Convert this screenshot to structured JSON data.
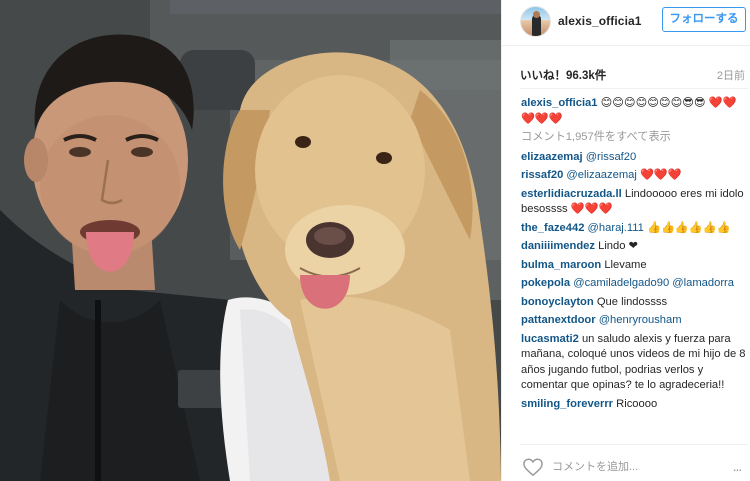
{
  "post": {
    "photo_alt": "Selfie with golden retriever in car",
    "icon": "photo"
  },
  "header": {
    "username": "alexis_officia1",
    "follow_label": "フォローする",
    "avatar_icon": "avatar-image"
  },
  "stats": {
    "likes": "いいね！96.3k件",
    "time": "2日前"
  },
  "caption": {
    "user": "alexis_officia1",
    "text": "😊😊😊😊😊😊😊😎😎 ❤️❤️❤️❤️❤️"
  },
  "view_all_comments": "コメント1,957件をすべて表示",
  "comments": [
    {
      "user": "elizaazemaj",
      "mention": "@rissaf20",
      "text": ""
    },
    {
      "user": "rissaf20",
      "mention": "@elizaazemaj",
      "text": "❤️❤️❤️"
    },
    {
      "user": "esterlidiacruzada.ll",
      "mention": "",
      "text": "Lindooooo eres mi idolo besossss ❤️❤️❤️"
    },
    {
      "user": "the_faze442",
      "mention": "@haraj.111",
      "text": "👍👍👍👍👍👍"
    },
    {
      "user": "daniiiimendez",
      "mention": "",
      "text": "Lindo ❤"
    },
    {
      "user": "bulma_maroon",
      "mention": "",
      "text": "Llevame"
    },
    {
      "user": "pokepola",
      "mention": "@camiladelgado90 @lamadorra",
      "text": ""
    },
    {
      "user": "bonoyclayton",
      "mention": "",
      "text": "Que lindossss"
    },
    {
      "user": "pattanextdoor",
      "mention": "@henryrousham",
      "text": ""
    },
    {
      "user": "lucasmati2",
      "mention": "",
      "text": "un saludo alexis y fuerza para mañana, coloqué unos videos de mi hijo de 8 años jugando futbol, podrias verlos y comentar que opinas? te lo agradeceria!!"
    },
    {
      "user": "smiling_foreverrr",
      "mention": "",
      "text": "Ricoooo"
    }
  ],
  "footer": {
    "comment_placeholder": "コメントを追加...",
    "like_icon": "heart-outline",
    "more_icon": "ellipsis",
    "more_glyph": "..."
  },
  "colors": {
    "link": "#125688",
    "follow_blue": "#3897f0",
    "muted": "#999999"
  }
}
